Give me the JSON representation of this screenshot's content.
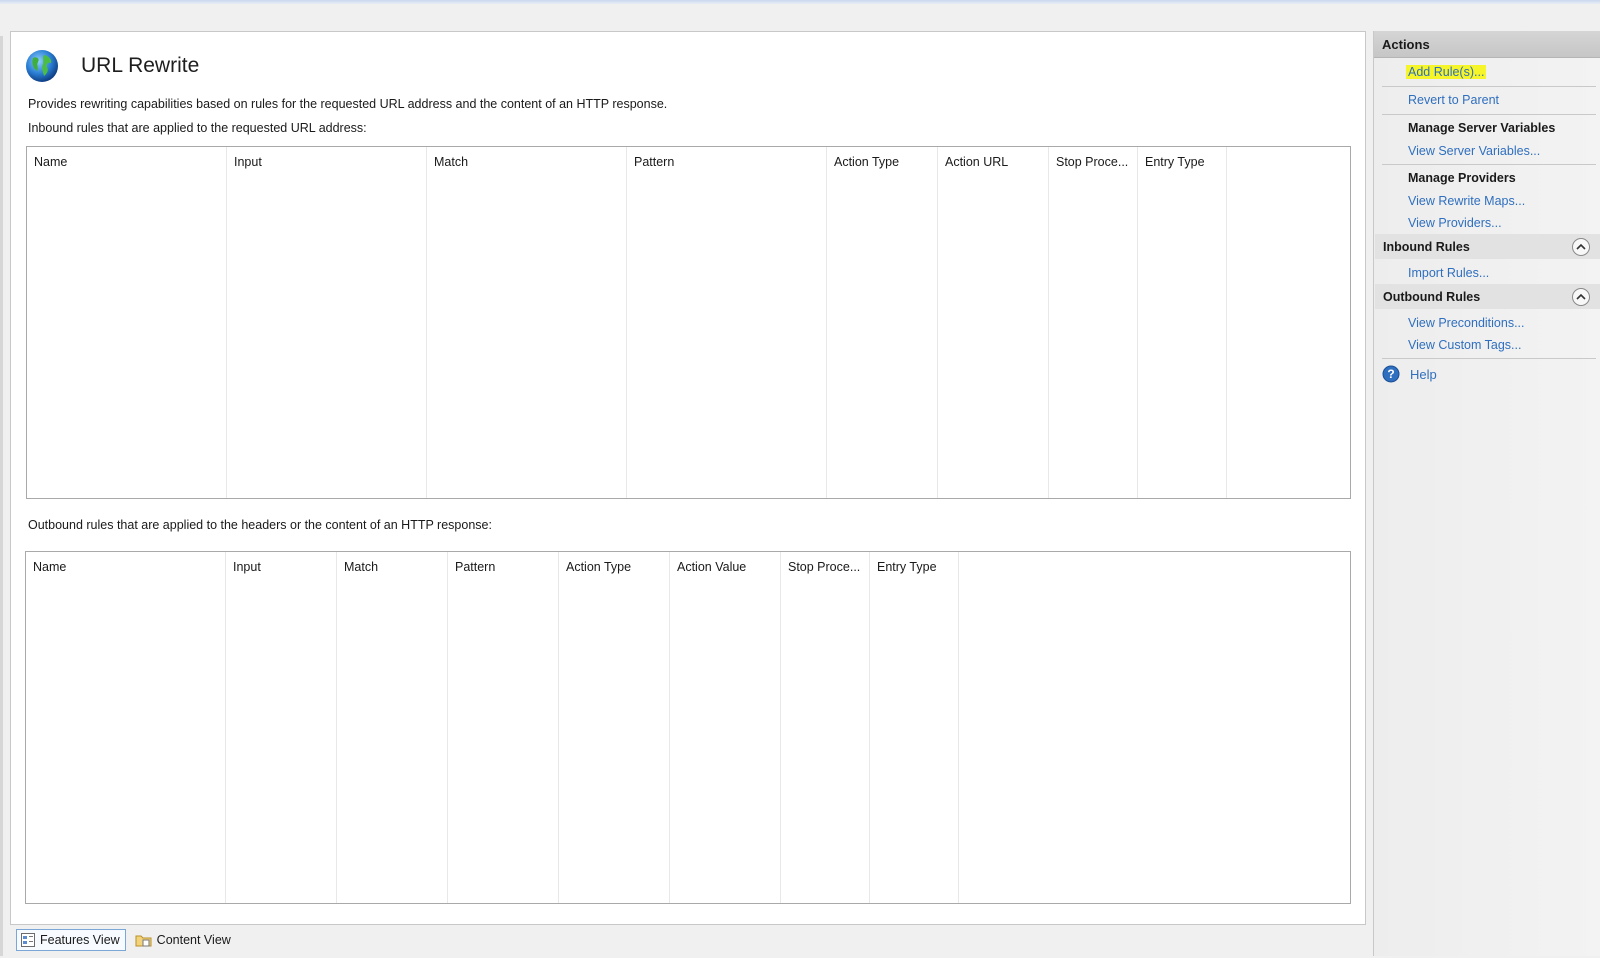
{
  "feature": {
    "title": "URL Rewrite",
    "description": "Provides rewriting capabilities based on rules for the requested URL address and the content of an HTTP response.",
    "inbound_caption": "Inbound rules that are applied to the requested URL address:",
    "outbound_caption": "Outbound rules that are applied to the headers or the content of an HTTP response:"
  },
  "inbound_table": {
    "columns": [
      "Name",
      "Input",
      "Match",
      "Pattern",
      "Action Type",
      "Action URL",
      "Stop Proce...",
      "Entry Type"
    ],
    "rows": []
  },
  "outbound_table": {
    "columns": [
      "Name",
      "Input",
      "Match",
      "Pattern",
      "Action Type",
      "Action Value",
      "Stop Proce...",
      "Entry Type"
    ],
    "rows": []
  },
  "bottom_tabs": [
    {
      "label": "Features View",
      "active": true
    },
    {
      "label": "Content View",
      "active": false
    }
  ],
  "actions": {
    "header": "Actions",
    "add_rules": "Add Rule(s)...",
    "revert_to_parent": "Revert to Parent",
    "manage_server_variables": "Manage Server Variables",
    "view_server_variables": "View Server Variables...",
    "manage_providers": "Manage Providers",
    "view_rewrite_maps": "View Rewrite Maps...",
    "view_providers": "View Providers...",
    "inbound_rules": "Inbound Rules",
    "import_rules": "Import Rules...",
    "outbound_rules": "Outbound Rules",
    "view_preconditions": "View Preconditions...",
    "view_custom_tags": "View Custom Tags...",
    "help": "Help"
  },
  "colors": {
    "link": "#2f6fbf",
    "highlight": "#f5f52a",
    "panel_bg": "#ffffff",
    "actions_header_bg": "#c6c6c6"
  },
  "icons": {
    "feature": "globe-icon",
    "features_view": "features-view-icon",
    "content_view": "content-view-icon",
    "help": "help-icon",
    "collapse": "chevron-up-icon"
  }
}
